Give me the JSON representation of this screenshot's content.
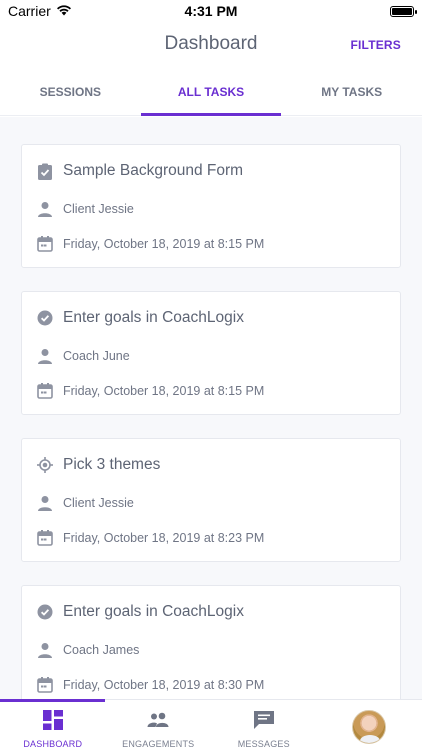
{
  "status_bar": {
    "carrier": "Carrier",
    "time": "4:31 PM"
  },
  "header": {
    "title": "Dashboard",
    "filters_label": "FILTERS"
  },
  "tabs": [
    {
      "label": "SESSIONS",
      "active": false
    },
    {
      "label": "ALL TASKS",
      "active": true
    },
    {
      "label": "MY TASKS",
      "active": false
    }
  ],
  "tasks": [
    {
      "title": "Sample Background Form",
      "type_icon": "clipboard-check-icon",
      "person": "Client Jessie",
      "date": "Friday, October 18, 2019 at 8:15 PM"
    },
    {
      "title": "Enter goals in CoachLogix",
      "type_icon": "check-circle-icon",
      "person": "Coach June",
      "date": "Friday, October 18, 2019 at 8:15 PM"
    },
    {
      "title": "Pick 3 themes",
      "type_icon": "target-icon",
      "person": "Client Jessie",
      "date": "Friday, October 18, 2019 at 8:23 PM"
    },
    {
      "title": "Enter goals in CoachLogix",
      "type_icon": "check-circle-icon",
      "person": "Coach James",
      "date": "Friday, October 18, 2019 at 8:30 PM"
    }
  ],
  "bottom_nav": [
    {
      "label": "DASHBOARD",
      "icon": "dashboard-icon",
      "active": true
    },
    {
      "label": "ENGAGEMENTS",
      "icon": "people-icon",
      "active": false
    },
    {
      "label": "MESSAGES",
      "icon": "chat-icon",
      "active": false
    },
    {
      "label": "",
      "icon": "avatar",
      "active": false
    }
  ],
  "colors": {
    "accent": "#6a2fd1",
    "text": "#5d6474",
    "icon": "#8e93a1",
    "background": "#f7f8fb"
  }
}
